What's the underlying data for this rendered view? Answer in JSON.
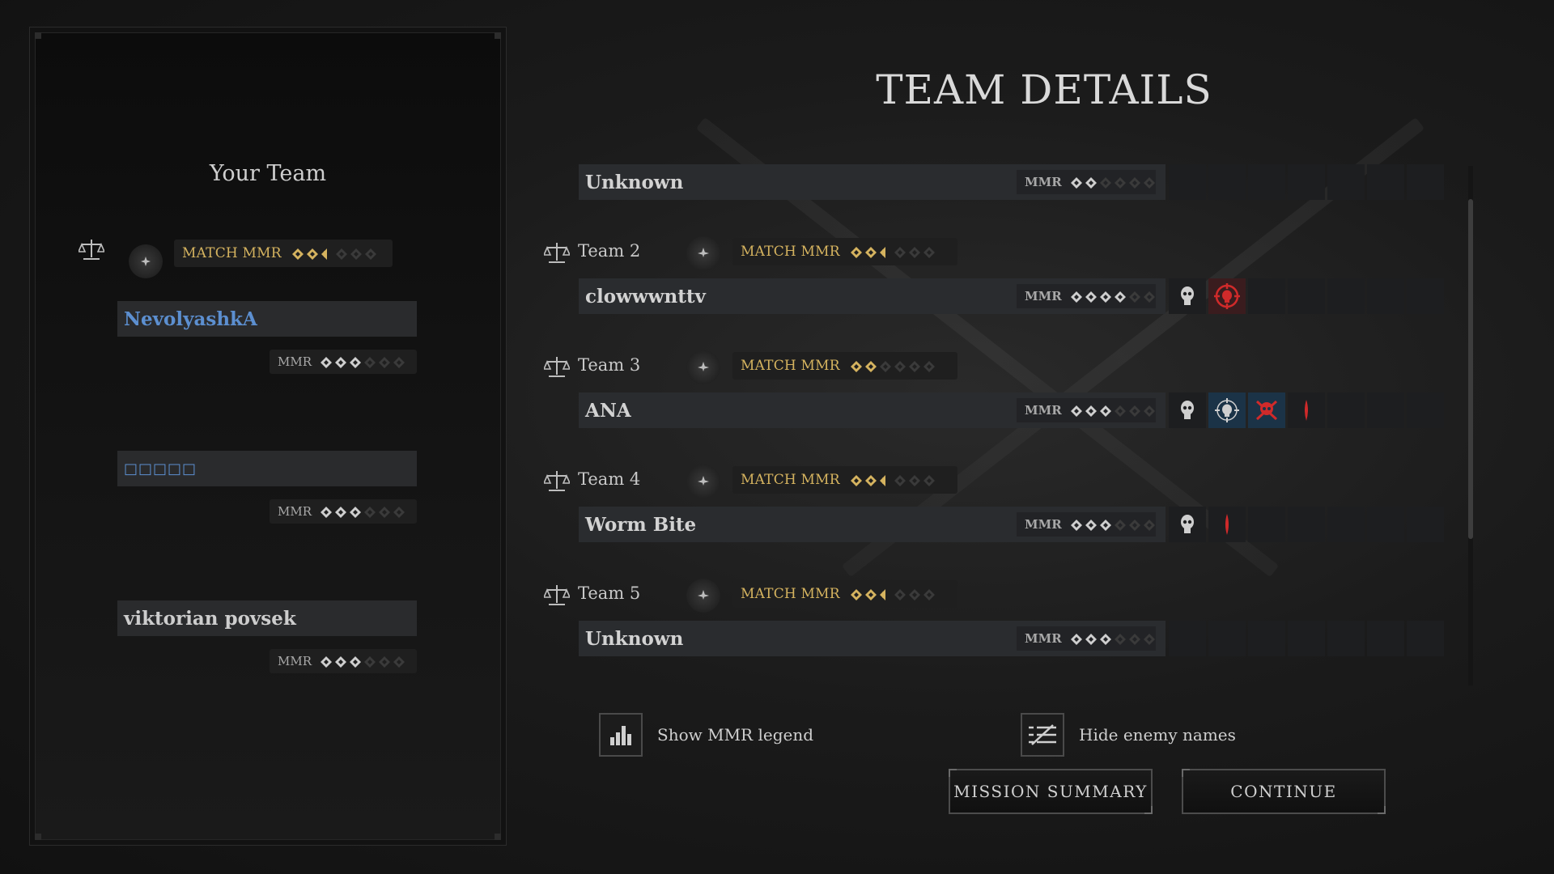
{
  "page_title": "TEAM DETAILS",
  "your_team": {
    "title": "Your Team",
    "match_label": "MATCH MMR",
    "match_stars": 2.5,
    "players": [
      {
        "name": "NevolyashkA",
        "mmr_label": "MMR",
        "stars": 3,
        "is_self": true
      },
      {
        "name": "□□□□□",
        "mmr_label": "MMR",
        "stars": 3
      },
      {
        "name": "viktorian povsek",
        "mmr_label": "MMR",
        "stars": 3
      }
    ]
  },
  "enemy_teams": [
    {
      "label": "",
      "solo": true,
      "player": "Unknown",
      "mmr_label": "MMR",
      "stars": 2,
      "kills": []
    },
    {
      "label": "Team 2",
      "match_label": "MATCH MMR",
      "match_stars": 2.5,
      "player": "clowwwnttv",
      "mmr_label": "MMR",
      "stars": 4,
      "kills": [
        "downed",
        "killed-by-you"
      ]
    },
    {
      "label": "Team 3",
      "match_label": "MATCH MMR",
      "match_stars": 2,
      "player": "ANA",
      "mmr_label": "MMR",
      "stars": 3,
      "kills": [
        "downed",
        "downed-by-team",
        "killed-you",
        "bleed"
      ]
    },
    {
      "label": "Team 4",
      "match_label": "MATCH MMR",
      "match_stars": 2.5,
      "player": "Worm Bite",
      "mmr_label": "MMR",
      "stars": 3,
      "kills": [
        "downed",
        "bleed"
      ]
    },
    {
      "label": "Team 5",
      "match_label": "MATCH MMR",
      "match_stars": 2.5,
      "player": "Unknown",
      "mmr_label": "MMR",
      "stars": 3,
      "kills": []
    }
  ],
  "toggles": {
    "mmr_legend": "Show MMR legend",
    "hide_names": "Hide enemy names"
  },
  "buttons": {
    "mission_summary": "MISSION SUMMARY",
    "continue": "CONTINUE"
  },
  "colors": {
    "gold": "#d5b35f",
    "self_name": "#5c8fd0",
    "kill_red": "#d02a2a"
  },
  "icons": [
    "scale-icon",
    "boost-icon",
    "skull-icon",
    "crosshair-skull-icon",
    "bleed-icon",
    "bar-chart-icon",
    "hide-names-icon"
  ]
}
